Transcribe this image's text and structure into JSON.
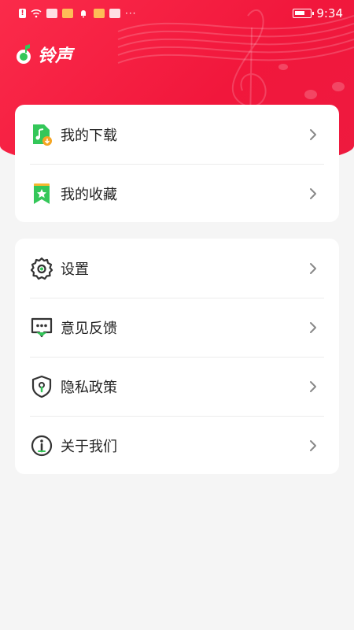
{
  "status_bar": {
    "time": "9:34",
    "battery_level": 0.7,
    "icons": [
      "sim-alert-icon",
      "wifi-icon",
      "app-icon",
      "weibo-icon",
      "mute-icon",
      "weibo-icon",
      "app-icon",
      "more-dots-icon",
      "battery-icon"
    ]
  },
  "header": {
    "app_title": "铃声",
    "logo_icon": "music-note-logo-icon"
  },
  "menu_group_1": [
    {
      "label": "我的下载",
      "icon": "download-music-icon"
    },
    {
      "label": "我的收藏",
      "icon": "bookmark-star-icon"
    }
  ],
  "menu_group_2": [
    {
      "label": "设置",
      "icon": "gear-icon"
    },
    {
      "label": "意见反馈",
      "icon": "feedback-icon"
    },
    {
      "label": "隐私政策",
      "icon": "shield-icon"
    },
    {
      "label": "关于我们",
      "icon": "info-icon"
    }
  ],
  "colors": {
    "accent": "#ee1a3f",
    "green": "#34c759",
    "page_bg": "#f5f5f5"
  }
}
